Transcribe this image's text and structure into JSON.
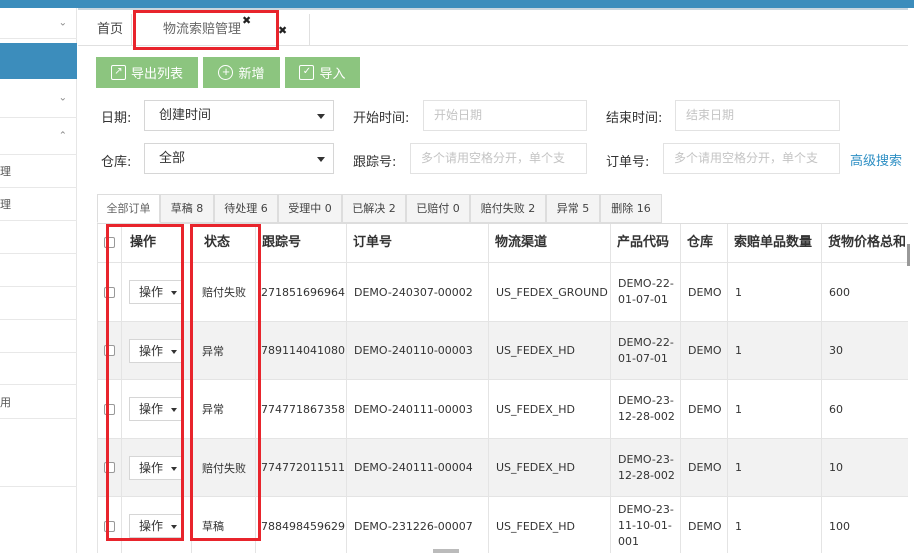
{
  "sidebar": {
    "items": [
      {
        "label": "",
        "chevron": "⌄"
      },
      {
        "label": "",
        "chevron": ""
      },
      {
        "label": "",
        "chevron": "⌄"
      },
      {
        "label": "",
        "chevron": "⌃"
      },
      {
        "label": "理",
        "chevron": ""
      },
      {
        "label": "理",
        "chevron": ""
      },
      {
        "label": "",
        "chevron": ""
      },
      {
        "label": "",
        "chevron": ""
      },
      {
        "label": "",
        "chevron": ""
      },
      {
        "label": "",
        "chevron": ""
      },
      {
        "label": "",
        "chevron": ""
      },
      {
        "label": "用",
        "chevron": ""
      },
      {
        "label": "",
        "chevron": ""
      }
    ]
  },
  "tabs": {
    "home": "首页",
    "active": "物流索赔管理",
    "close_glyph": "✖"
  },
  "toolbar": {
    "export": "导出列表",
    "add": "新增",
    "import": "导入"
  },
  "filters": {
    "date_label": "日期:",
    "date_value": "创建时间",
    "start_label": "开始时间:",
    "start_placeholder": "开始日期",
    "end_label": "结束时间:",
    "end_placeholder": "结束日期",
    "warehouse_label": "仓库:",
    "warehouse_value": "全部",
    "tracking_label": "跟踪号:",
    "tracking_placeholder": "多个请用空格分开，单个支",
    "order_label": "订单号:",
    "order_placeholder": "多个请用空格分开，单个支",
    "advanced": "高级搜索"
  },
  "status_tabs": [
    "全部订单",
    "草稿 8",
    "待处理 6",
    "受理中 0",
    "已解决 2",
    "已赔付 0",
    "赔付失败 2",
    "异常 5",
    "删除 16"
  ],
  "table": {
    "headers": [
      "操作",
      "状态",
      "跟踪号",
      "订单号",
      "物流渠道",
      "产品代码",
      "仓库",
      "索赔单品数量",
      "货物价格总和"
    ],
    "op_label": "操作",
    "rows": [
      {
        "status": "赔付失败",
        "tracking": "271851696964",
        "order": "DEMO-240307-00002",
        "channel": "US_FEDEX_GROUND",
        "product": "DEMO-22-01-07-01",
        "warehouse": "DEMO",
        "qty": "1",
        "price": "600"
      },
      {
        "status": "异常",
        "tracking": "789114041080",
        "order": "DEMO-240110-00003",
        "channel": "US_FEDEX_HD",
        "product": "DEMO-22-01-07-01",
        "warehouse": "DEMO",
        "qty": "1",
        "price": "30"
      },
      {
        "status": "异常",
        "tracking": "774771867358",
        "order": "DEMO-240111-00003",
        "channel": "US_FEDEX_HD",
        "product": "DEMO-23-12-28-002",
        "warehouse": "DEMO",
        "qty": "1",
        "price": "60"
      },
      {
        "status": "赔付失败",
        "tracking": "774772011511",
        "order": "DEMO-240111-00004",
        "channel": "US_FEDEX_HD",
        "product": "DEMO-23-12-28-002",
        "warehouse": "DEMO",
        "qty": "1",
        "price": "10"
      },
      {
        "status": "草稿",
        "tracking": "788498459629",
        "order": "DEMO-231226-00007",
        "channel": "US_FEDEX_HD",
        "product": "DEMO-23-11-10-01-001",
        "warehouse": "DEMO",
        "qty": "1",
        "price": "100"
      }
    ]
  },
  "colors": {
    "accent": "#3c8dbc",
    "button_green": "#8cc57f",
    "highlight_red": "#e8242c",
    "link_blue": "#2e8fc4"
  }
}
